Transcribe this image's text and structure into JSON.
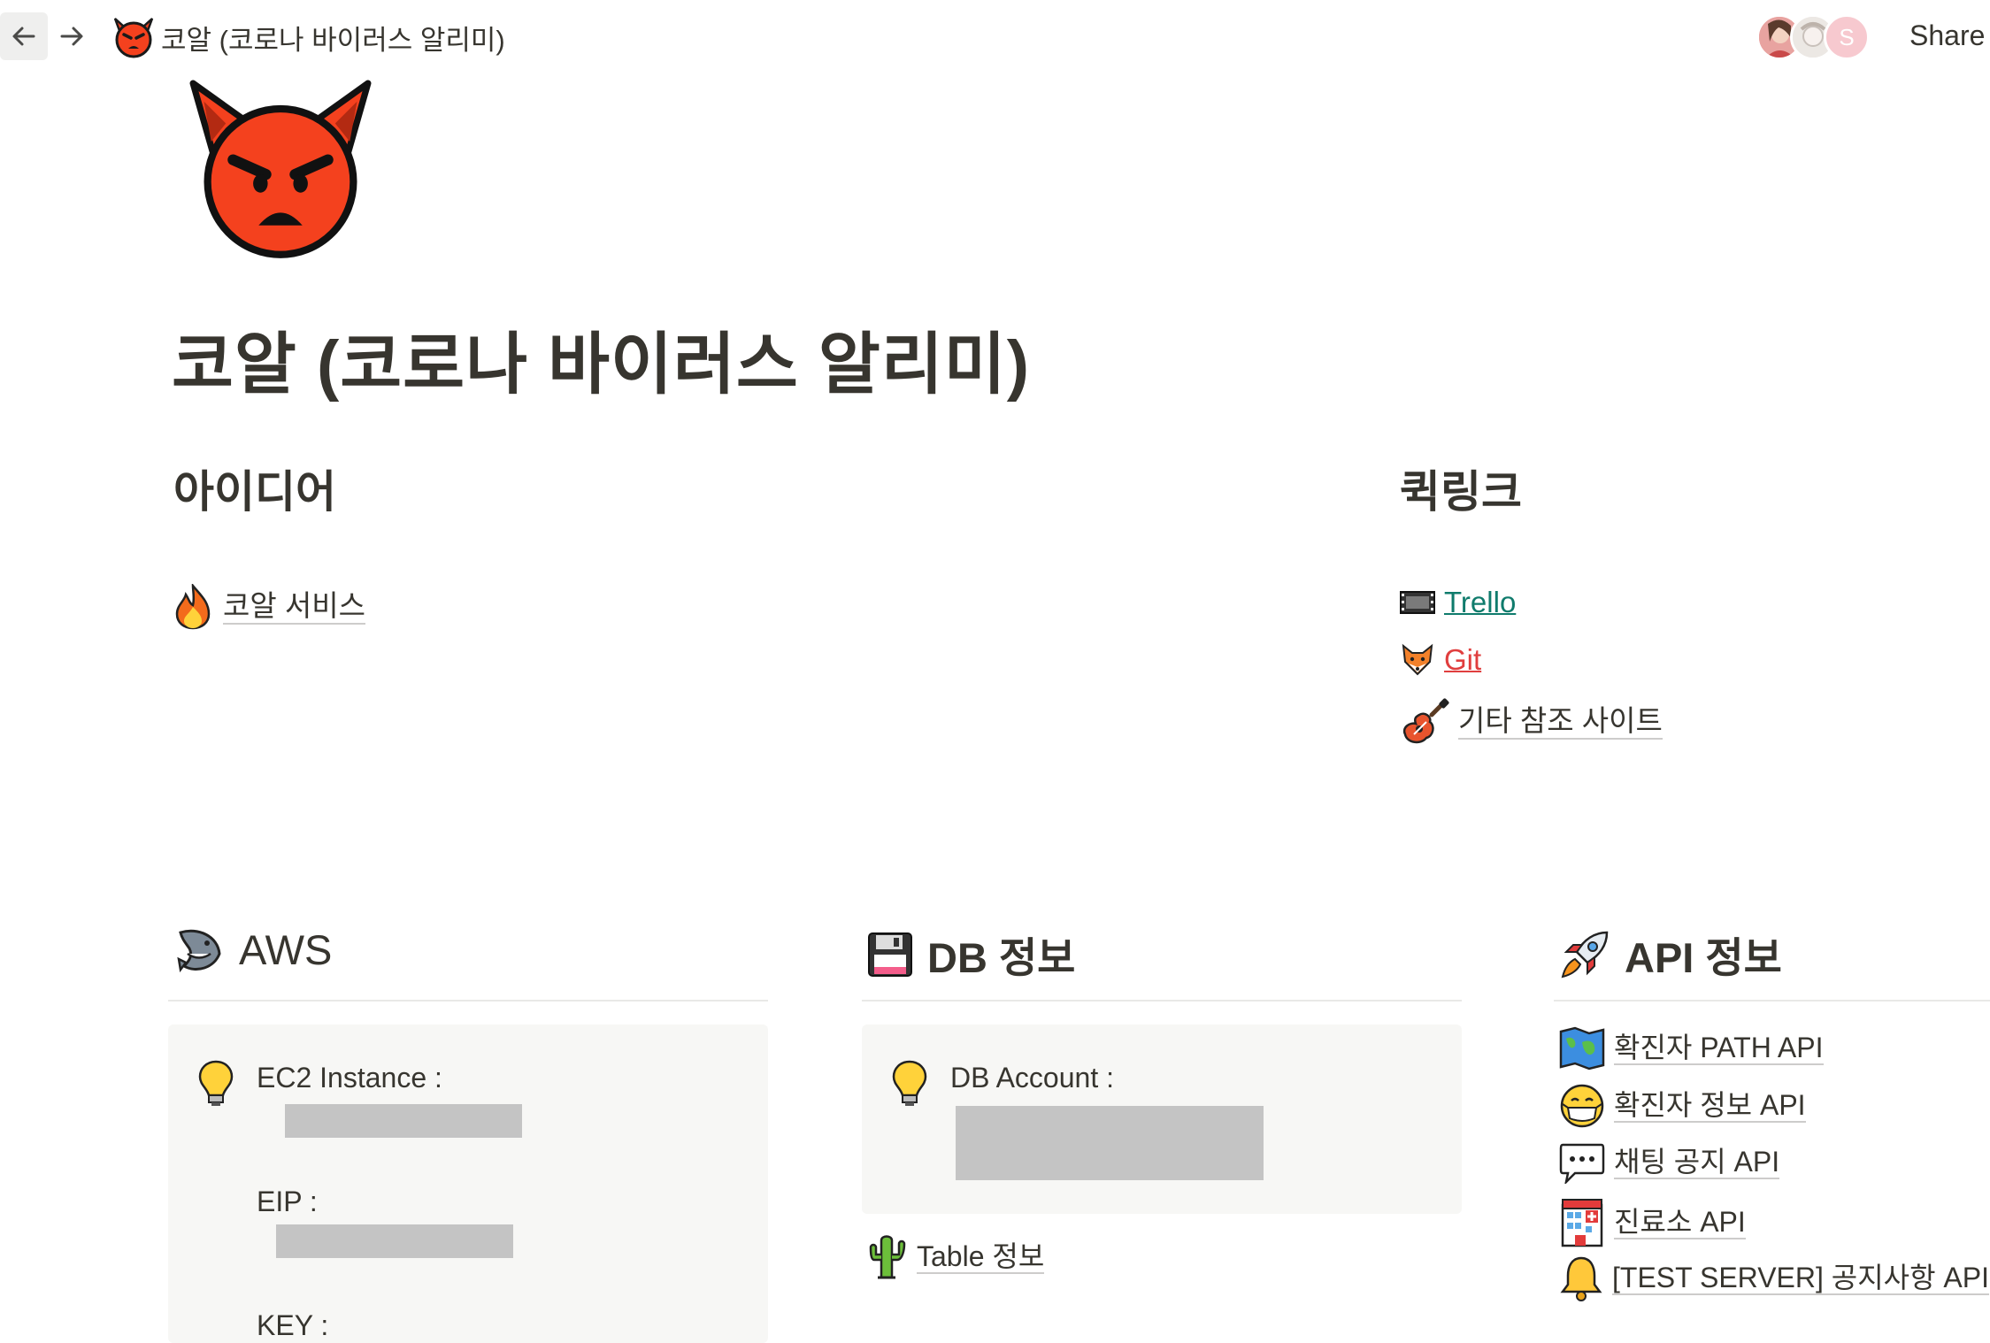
{
  "topbar": {
    "breadcrumb_title": "코알 (코로나 바이러스 알리미)",
    "breadcrumb_icon": "angry-devil-icon",
    "share_label": "Share",
    "avatar_initial": "S"
  },
  "page": {
    "icon": "angry-devil-icon",
    "title": "코알 (코로나 바이러스 알리미)"
  },
  "ideas": {
    "heading": "아이디어",
    "items": [
      {
        "icon": "fire-icon",
        "label": "코알 서비스"
      }
    ]
  },
  "quicklinks": {
    "heading": "퀵링크",
    "items": [
      {
        "icon": "film-strip-icon",
        "label": "Trello",
        "color": "#0f7b6c"
      },
      {
        "icon": "fox-icon",
        "label": "Git",
        "color": "#e03e3e"
      },
      {
        "icon": "guitar-icon",
        "label": "기타 참조 사이트"
      }
    ]
  },
  "aws": {
    "heading": "AWS",
    "icon": "shark-icon",
    "callout_icon": "lightbulb-icon",
    "lines": {
      "ec2": "EC2 Instance :",
      "eip": "EIP :",
      "key": "KEY :"
    }
  },
  "db": {
    "heading": "DB 정보",
    "icon": "floppy-disk-icon",
    "callout_icon": "lightbulb-icon",
    "account_label": "DB Account :",
    "table_link": {
      "icon": "cactus-icon",
      "label": "Table 정보"
    }
  },
  "api": {
    "heading": "API 정보",
    "icon": "rocket-icon",
    "items": [
      {
        "icon": "world-map-icon",
        "label": "확진자 PATH API"
      },
      {
        "icon": "mask-face-icon",
        "label": "확진자 정보 API"
      },
      {
        "icon": "speech-bubble-icon",
        "label": "채팅 공지 API"
      },
      {
        "icon": "hospital-icon",
        "label": "진료소 API"
      },
      {
        "icon": "bell-icon",
        "label": "[TEST SERVER] 공지사항 API"
      }
    ]
  },
  "colors": {
    "text": "#37352f",
    "link_green": "#0f7b6c",
    "link_red": "#e03e3e",
    "callout_bg": "#f7f7f5",
    "redaction": "#c4c4c4",
    "devil_red": "#f4411e"
  }
}
